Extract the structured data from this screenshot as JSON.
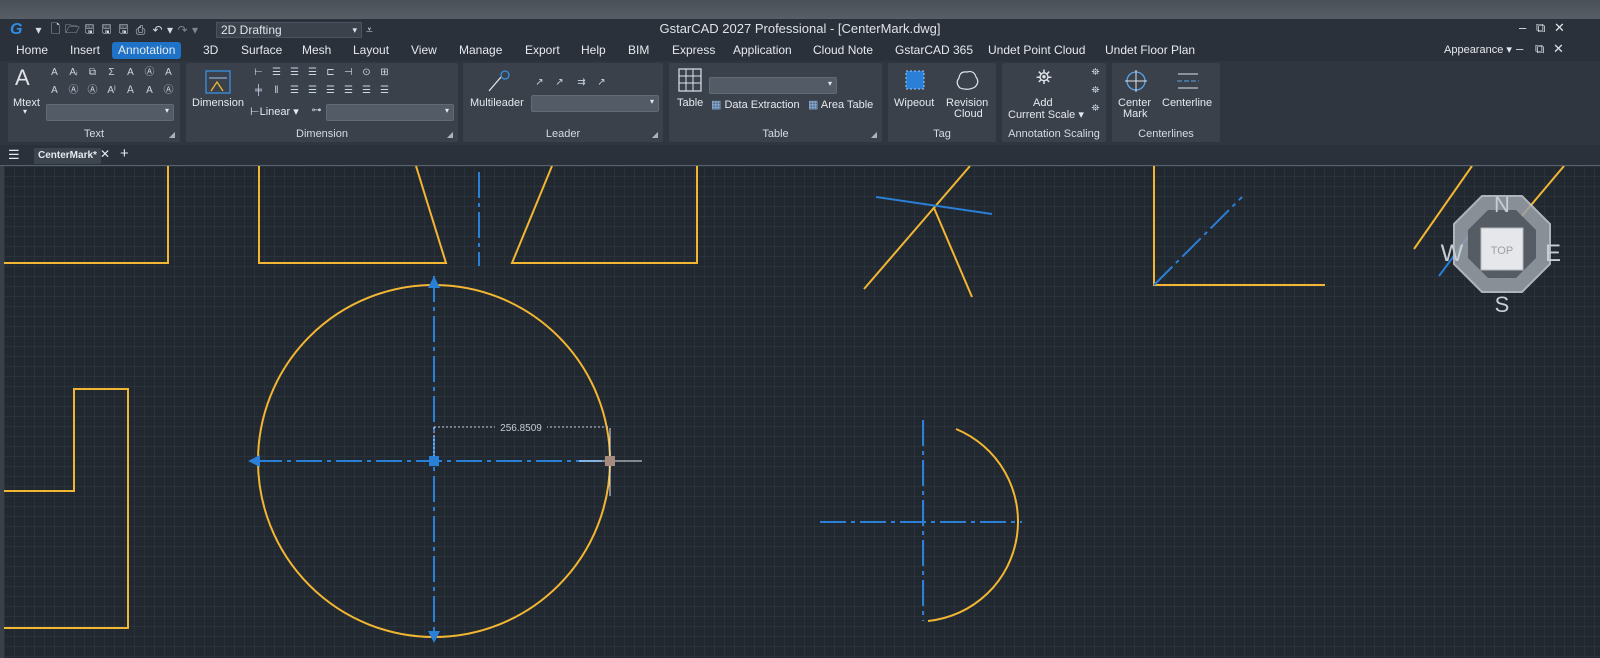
{
  "app": {
    "logo": "G",
    "title": "GstarCAD 2027 Professional - [CenterMark.dwg]",
    "workspace": "2D Drafting",
    "appearance": "Appearance"
  },
  "menu": [
    "Home",
    "Insert",
    "Annotation",
    "3D",
    "Surface",
    "Mesh",
    "Layout",
    "View",
    "Manage",
    "Export",
    "Help",
    "BIM",
    "Express",
    "Application",
    "Cloud Note",
    "GstarCAD 365",
    "Undet Point Cloud",
    "Undet Floor Plan"
  ],
  "active_menu": "Annotation",
  "ribbon": {
    "text": {
      "title": "Text",
      "mtext": "Mtext"
    },
    "dimension": {
      "title": "Dimension",
      "button": "Dimension",
      "linear": "Linear"
    },
    "leader": {
      "title": "Leader",
      "button": "Multileader"
    },
    "table": {
      "title": "Table",
      "button": "Table",
      "extraction": "Data Extraction",
      "area": "Area Table"
    },
    "tag": {
      "title": "Tag",
      "wipeout": "Wipeout",
      "revision1": "Revision",
      "revision2": "Cloud"
    },
    "scaling": {
      "title": "Annotation Scaling",
      "add1": "Add",
      "add2": "Current Scale"
    },
    "centerlines": {
      "title": "Centerlines",
      "mark1": "Center",
      "mark2": "Mark",
      "centerline": "Centerline"
    }
  },
  "doc_tab": "CenterMark*",
  "drawing": {
    "dimension_value": "256.8509",
    "viewcube": {
      "n": "N",
      "s": "S",
      "e": "E",
      "w": "W",
      "top": "TOP"
    }
  },
  "colors": {
    "geometry": "#f2b632",
    "centerline": "#2a7fd6",
    "accent": "#1e73c8"
  }
}
